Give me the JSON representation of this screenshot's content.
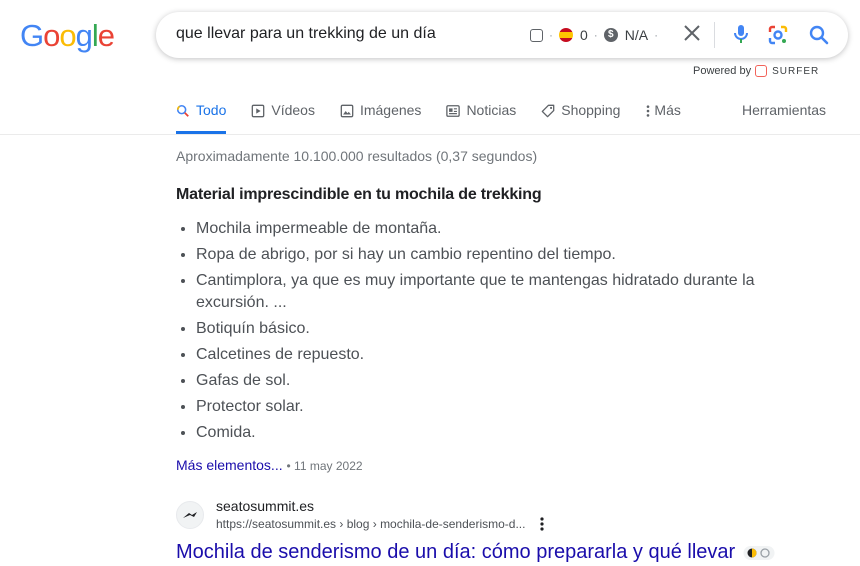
{
  "logo": {
    "letters": [
      "G",
      "o",
      "o",
      "g",
      "l",
      "e"
    ],
    "colors": [
      "#4285F4",
      "#EA4335",
      "#FBBC05",
      "#4285F4",
      "#34A853",
      "#EA4335"
    ]
  },
  "search": {
    "query": "que llevar para un trekking de un día",
    "widget_count": "0",
    "widget_value": "N/A"
  },
  "powered_by": {
    "label": "Powered by",
    "brand": "SURFER"
  },
  "tabs": [
    {
      "label": "Todo",
      "icon": "search-icon",
      "active": true
    },
    {
      "label": "Vídeos",
      "icon": "video-icon",
      "active": false
    },
    {
      "label": "Imágenes",
      "icon": "image-icon",
      "active": false
    },
    {
      "label": "Noticias",
      "icon": "news-icon",
      "active": false
    },
    {
      "label": "Shopping",
      "icon": "tag-icon",
      "active": false
    },
    {
      "label": "Más",
      "icon": "more-vert-icon",
      "active": false
    }
  ],
  "tools_label": "Herramientas",
  "result_stats": "Aproximadamente 10.100.000 resultados (0,37 segundos)",
  "snippet": {
    "title": "Material imprescindible en tu mochila de trekking",
    "items": [
      "Mochila impermeable de montaña.",
      "Ropa de abrigo, por si hay un cambio repentino del tiempo.",
      "Cantimplora, ya que es muy importante que te mantengas hidratado durante la excursión. ...",
      "Botiquín básico.",
      "Calcetines de repuesto.",
      "Gafas de sol.",
      "Protector solar.",
      "Comida."
    ],
    "more_link": "Más elementos...",
    "date": "11 may 2022"
  },
  "result": {
    "site_name": "seatosummit.es",
    "url": "https://seatosummit.es › blog › mochila-de-senderismo-d...",
    "title": "Mochila de senderismo de un día: cómo prepararla y qué llevar"
  },
  "colors": {
    "accent": "#1a73e8",
    "link": "#1a0dab"
  }
}
